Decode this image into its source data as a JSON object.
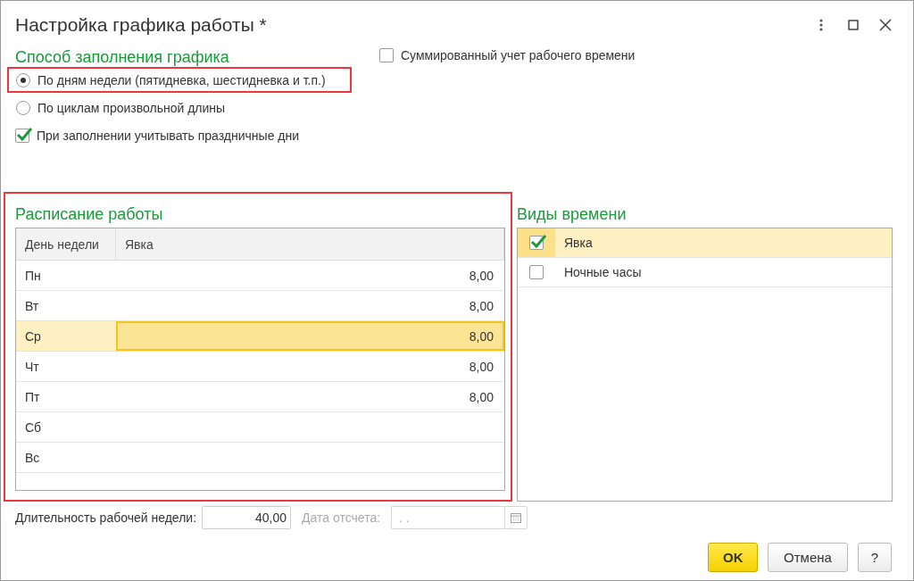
{
  "window": {
    "title": "Настройка графика работы *"
  },
  "fill_method": {
    "heading": "Способ заполнения графика",
    "options": [
      {
        "label": "По дням недели (пятидневка, шестидневка и т.п.)",
        "selected": true,
        "highlighted": true
      },
      {
        "label": "По циклам произвольной длины",
        "selected": false,
        "highlighted": false
      }
    ]
  },
  "consider_holidays": {
    "label": "При заполнении учитывать праздничные дни",
    "checked": true
  },
  "summarized_accounting": {
    "label": "Суммированный учет рабочего времени",
    "checked": false
  },
  "schedule": {
    "heading": "Расписание работы",
    "highlighted": true,
    "columns": [
      "День недели",
      "Явка"
    ],
    "rows": [
      {
        "day": "Пн",
        "hours": "8,00",
        "selected": false
      },
      {
        "day": "Вт",
        "hours": "8,00",
        "selected": false
      },
      {
        "day": "Ср",
        "hours": "8,00",
        "selected": true
      },
      {
        "day": "Чт",
        "hours": "8,00",
        "selected": false
      },
      {
        "day": "Пт",
        "hours": "8,00",
        "selected": false
      },
      {
        "day": "Сб",
        "selected": false
      },
      {
        "day": "Вс",
        "selected": false
      }
    ]
  },
  "time_types": {
    "heading": "Виды времени",
    "rows": [
      {
        "label": "Явка",
        "checked": true,
        "selected": true
      },
      {
        "label": "Ночные часы",
        "checked": false,
        "selected": false
      }
    ]
  },
  "week_length": {
    "label": "Длительность рабочей недели:",
    "value": "40,00"
  },
  "start_date": {
    "label": "Дата отсчета:",
    "value": ". .",
    "disabled": true
  },
  "buttons": [
    {
      "label": "OK",
      "kind": "primary"
    },
    {
      "label": "Отмена",
      "kind": "default"
    },
    {
      "label": "?",
      "kind": "help"
    }
  ]
}
